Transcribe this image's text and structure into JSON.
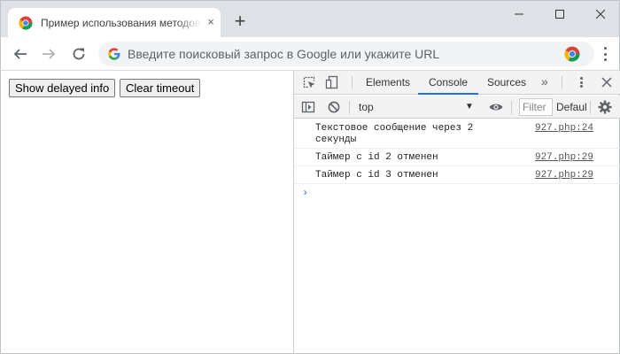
{
  "tab": {
    "title": "Пример использования методов",
    "close": "×",
    "new_tab": "+"
  },
  "omnibox": {
    "placeholder": "Введите поисковый запрос в Google или укажите URL",
    "g_letter": "G"
  },
  "page": {
    "buttons": [
      {
        "label": "Show delayed info"
      },
      {
        "label": "Clear timeout"
      }
    ]
  },
  "devtools": {
    "tabs": [
      {
        "label": "Elements",
        "active": false
      },
      {
        "label": "Console",
        "active": true
      },
      {
        "label": "Sources",
        "active": false
      }
    ],
    "more_tabs": "»",
    "context": "top",
    "filter_placeholder": "Filter",
    "levels": "Default levels",
    "messages": [
      {
        "text": "Текстовое сообщение через 2 секунды",
        "source": "927.php:24"
      },
      {
        "text": "Таймер с id 2 отменен",
        "source": "927.php:29"
      },
      {
        "text": "Таймер с id 3 отменен",
        "source": "927.php:29"
      }
    ],
    "prompt": "›"
  },
  "colors": {
    "accent": "#1a73e8",
    "tab_bar": "#dee1e6",
    "devtools_bar": "#f3f3f3"
  }
}
